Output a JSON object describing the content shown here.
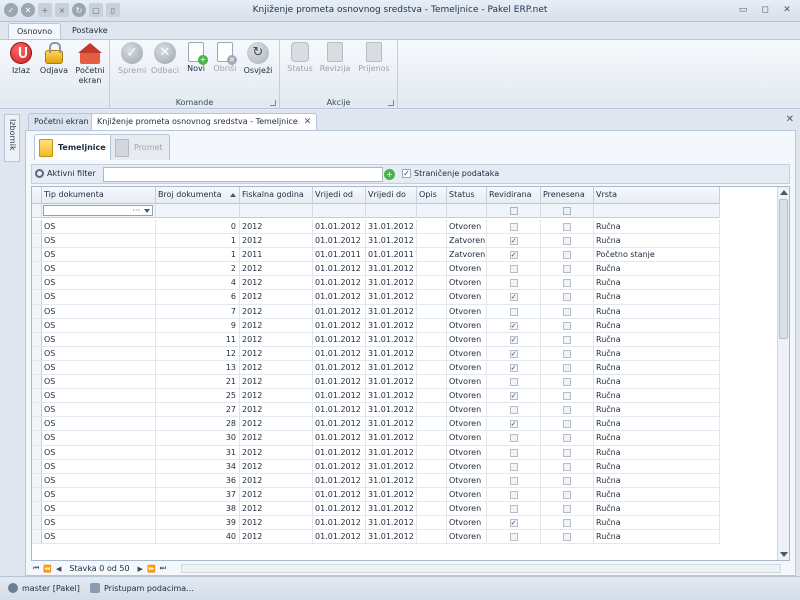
{
  "window": {
    "title": "Knjiženje prometa osnovnog sredstva - Temeljnice - Pakel ERP.net"
  },
  "ribbon": {
    "tabs": [
      "Osnovno",
      "Postavke"
    ],
    "groups": [
      {
        "label": ""
      },
      {
        "label": "Komande"
      },
      {
        "label": "Akcije"
      }
    ],
    "buttons": {
      "izlaz": "Izlaz",
      "odjava": "Odjava",
      "pocetni_ekran": "Početni\nekran",
      "spremi": "Spremi",
      "odbaci": "Odbaci",
      "novi": "Novi",
      "obrisi": "Obriši",
      "osvjezi": "Osvježi",
      "status": "Status",
      "revizija": "Revizija",
      "prijenos": "Prijenos"
    }
  },
  "side_panel": {
    "label": "Izbornik"
  },
  "doc_tabs": [
    "Početni ekran",
    "Knjiženje prometa osnovnog sredstva - Temeljnice"
  ],
  "inner_tabs": [
    "Temeljnice",
    "Promet"
  ],
  "filter": {
    "label": "Aktivni filter",
    "value": "",
    "paging_label": "Straničenje podataka",
    "paging_checked": true
  },
  "grid": {
    "columns": [
      "Tip dokumenta",
      "Broj dokumenta",
      "Fiskalna godina",
      "Vrijedi od",
      "Vrijedi do",
      "Opis",
      "Status",
      "Revidirana",
      "Prenesena",
      "Vrsta"
    ],
    "rows": [
      [
        "OS",
        "0",
        "2012",
        "01.01.2012",
        "31.01.2012",
        "",
        "Otvoren",
        false,
        false,
        "Ručna"
      ],
      [
        "OS",
        "1",
        "2012",
        "01.01.2012",
        "31.01.2012",
        "",
        "Zatvoren",
        true,
        false,
        "Ručna"
      ],
      [
        "OS",
        "1",
        "2011",
        "01.01.2011",
        "01.01.2011",
        "",
        "Zatvoren",
        true,
        false,
        "Početno stanje"
      ],
      [
        "OS",
        "2",
        "2012",
        "01.01.2012",
        "31.01.2012",
        "",
        "Otvoren",
        false,
        false,
        "Ručna"
      ],
      [
        "OS",
        "4",
        "2012",
        "01.01.2012",
        "31.01.2012",
        "",
        "Otvoren",
        false,
        false,
        "Ručna"
      ],
      [
        "OS",
        "6",
        "2012",
        "01.01.2012",
        "31.01.2012",
        "",
        "Otvoren",
        true,
        false,
        "Ručna"
      ],
      [
        "OS",
        "7",
        "2012",
        "01.01.2012",
        "31.01.2012",
        "",
        "Otvoren",
        false,
        false,
        "Ručna"
      ],
      [
        "OS",
        "9",
        "2012",
        "01.01.2012",
        "31.01.2012",
        "",
        "Otvoren",
        true,
        false,
        "Ručna"
      ],
      [
        "OS",
        "11",
        "2012",
        "01.01.2012",
        "31.01.2012",
        "",
        "Otvoren",
        true,
        false,
        "Ručna"
      ],
      [
        "OS",
        "12",
        "2012",
        "01.01.2012",
        "31.01.2012",
        "",
        "Otvoren",
        true,
        false,
        "Ručna"
      ],
      [
        "OS",
        "13",
        "2012",
        "01.01.2012",
        "31.01.2012",
        "",
        "Otvoren",
        true,
        false,
        "Ručna"
      ],
      [
        "OS",
        "21",
        "2012",
        "01.01.2012",
        "31.01.2012",
        "",
        "Otvoren",
        false,
        false,
        "Ručna"
      ],
      [
        "OS",
        "25",
        "2012",
        "01.01.2012",
        "31.01.2012",
        "",
        "Otvoren",
        true,
        false,
        "Ručna"
      ],
      [
        "OS",
        "27",
        "2012",
        "01.01.2012",
        "31.01.2012",
        "",
        "Otvoren",
        false,
        false,
        "Ručna"
      ],
      [
        "OS",
        "28",
        "2012",
        "01.01.2012",
        "31.01.2012",
        "",
        "Otvoren",
        true,
        false,
        "Ručna"
      ],
      [
        "OS",
        "30",
        "2012",
        "01.01.2012",
        "31.01.2012",
        "",
        "Otvoren",
        false,
        false,
        "Ručna"
      ],
      [
        "OS",
        "31",
        "2012",
        "01.01.2012",
        "31.01.2012",
        "",
        "Otvoren",
        false,
        false,
        "Ručna"
      ],
      [
        "OS",
        "34",
        "2012",
        "01.01.2012",
        "31.01.2012",
        "",
        "Otvoren",
        false,
        false,
        "Ručna"
      ],
      [
        "OS",
        "36",
        "2012",
        "01.01.2012",
        "31.01.2012",
        "",
        "Otvoren",
        false,
        false,
        "Ručna"
      ],
      [
        "OS",
        "37",
        "2012",
        "01.01.2012",
        "31.01.2012",
        "",
        "Otvoren",
        false,
        false,
        "Ručna"
      ],
      [
        "OS",
        "38",
        "2012",
        "01.01.2012",
        "31.01.2012",
        "",
        "Otvoren",
        false,
        false,
        "Ručna"
      ],
      [
        "OS",
        "39",
        "2012",
        "01.01.2012",
        "31.01.2012",
        "",
        "Otvoren",
        true,
        false,
        "Ručna"
      ],
      [
        "OS",
        "40",
        "2012",
        "01.01.2012",
        "31.01.2012",
        "",
        "Otvoren",
        false,
        false,
        "Ručna"
      ]
    ]
  },
  "navigator": {
    "record_text": "Stavka 0 od 50"
  },
  "statusbar": {
    "user": "master [Pakel]",
    "activity": "Pristupam podacima..."
  },
  "colors": {
    "accent": "#1f3350",
    "power_red": "#c81e1e",
    "new_green": "#49b04a",
    "delete_red": "#c0392b"
  }
}
